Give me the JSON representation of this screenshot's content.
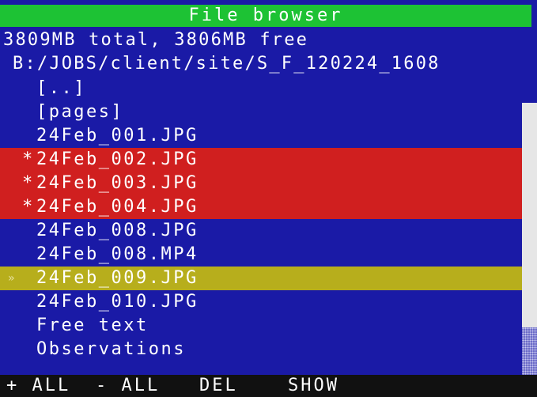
{
  "title": "File browser",
  "storage_info": "3809MB total, 3806MB free",
  "path": "B:/JOBS/client/site/S_F_120224_1608",
  "files": [
    {
      "mark": "",
      "name": "[..]",
      "state": "normal"
    },
    {
      "mark": "",
      "name": "[pages]",
      "state": "normal"
    },
    {
      "mark": "",
      "name": "24Feb_001.JPG",
      "state": "normal"
    },
    {
      "mark": "*",
      "name": "24Feb_002.JPG",
      "state": "marked"
    },
    {
      "mark": "*",
      "name": "24Feb_003.JPG",
      "state": "marked"
    },
    {
      "mark": "*",
      "name": "24Feb_004.JPG",
      "state": "marked"
    },
    {
      "mark": "",
      "name": "24Feb_008.JPG",
      "state": "normal"
    },
    {
      "mark": "",
      "name": "24Feb_008.MP4",
      "state": "normal"
    },
    {
      "mark": "»",
      "name": "24Feb_009.JPG",
      "state": "cursor"
    },
    {
      "mark": "",
      "name": "24Feb_010.JPG",
      "state": "normal"
    },
    {
      "mark": "",
      "name": "Free text",
      "state": "normal"
    },
    {
      "mark": "",
      "name": "Observations",
      "state": "normal"
    }
  ],
  "footer": {
    "add_all": "+ ALL",
    "remove_all": "- ALL",
    "delete": "DEL",
    "show": "SHOW"
  },
  "colors": {
    "background": "#1a1aa6",
    "title_bar": "#1dc234",
    "marked_row": "#d01f1f",
    "cursor_row": "#b7ae1c",
    "footer": "#111111"
  }
}
